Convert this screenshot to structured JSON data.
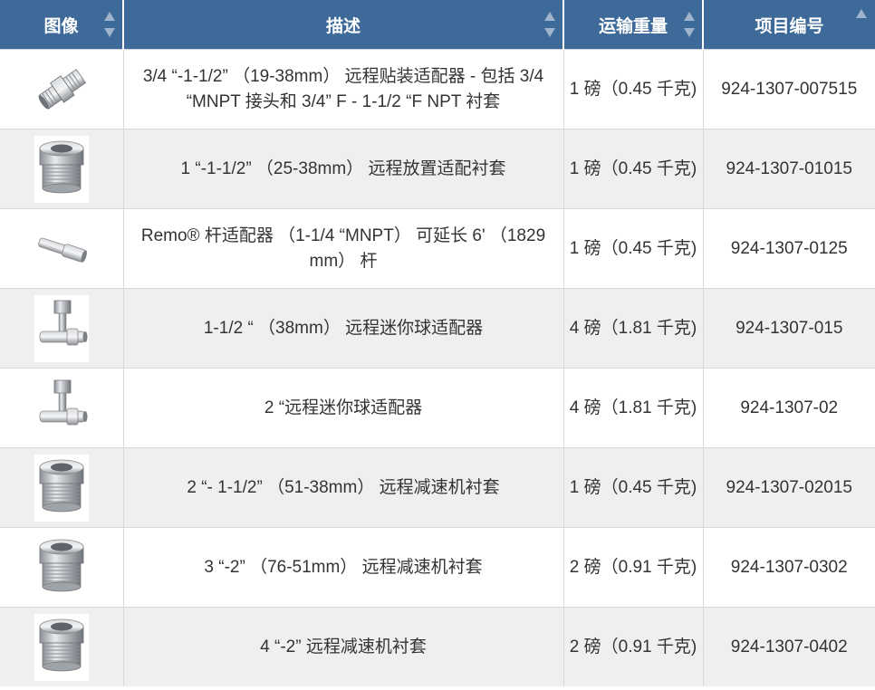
{
  "table": {
    "headers": {
      "image": "图像",
      "description": "描述",
      "shipping_weight": "运输重量",
      "item_number": "项目编号"
    },
    "rows": [
      {
        "icon": "hex-nipple-fitting-icon",
        "description": "3/4 “-1-1/2” （19-38mm） 远程贴装适配器 - 包括 3/4 “MNPT 接头和 3/4” F - 1-1/2 “F NPT 衬套",
        "weight": "1 磅（0.45 千克)",
        "sku": "924-1307-007515"
      },
      {
        "icon": "hex-bushing-icon",
        "description": "1 “-1-1/2” （25-38mm） 远程放置适配衬套",
        "weight": "1 磅（0.45 千克)",
        "sku": "924-1307-01015"
      },
      {
        "icon": "pipe-rod-icon",
        "description": "Remo® 杆适配器 （1-1/4 “MNPT） 可延长 6' （1829 mm） 杆",
        "weight": "1 磅（0.45 千克)",
        "sku": "924-1307-0125"
      },
      {
        "icon": "tee-ball-adapter-icon",
        "description": "1-1/2 “ （38mm） 远程迷你球适配器",
        "weight": "4 磅（1.81 千克)",
        "sku": "924-1307-015"
      },
      {
        "icon": "tee-ball-adapter-icon",
        "description": "2 “远程迷你球适配器",
        "weight": "4 磅（1.81 千克)",
        "sku": "924-1307-02"
      },
      {
        "icon": "hex-bushing-icon",
        "description": "2 “- 1-1/2” （51-38mm） 远程减速机衬套",
        "weight": "1 磅（0.45 千克)",
        "sku": "924-1307-02015"
      },
      {
        "icon": "hex-bushing-icon",
        "description": "3 “-2” （76-51mm） 远程减速机衬套",
        "weight": "2 磅（0.91 千克)",
        "sku": "924-1307-0302"
      },
      {
        "icon": "hex-bushing-icon",
        "description": "4 “-2” 远程减速机衬套",
        "weight": "2 磅（0.91 千克)",
        "sku": "924-1307-0402"
      }
    ]
  },
  "colors": {
    "header_bg": "#3e6a9a",
    "link": "#1f4e99",
    "alt_row": "#efefef"
  }
}
